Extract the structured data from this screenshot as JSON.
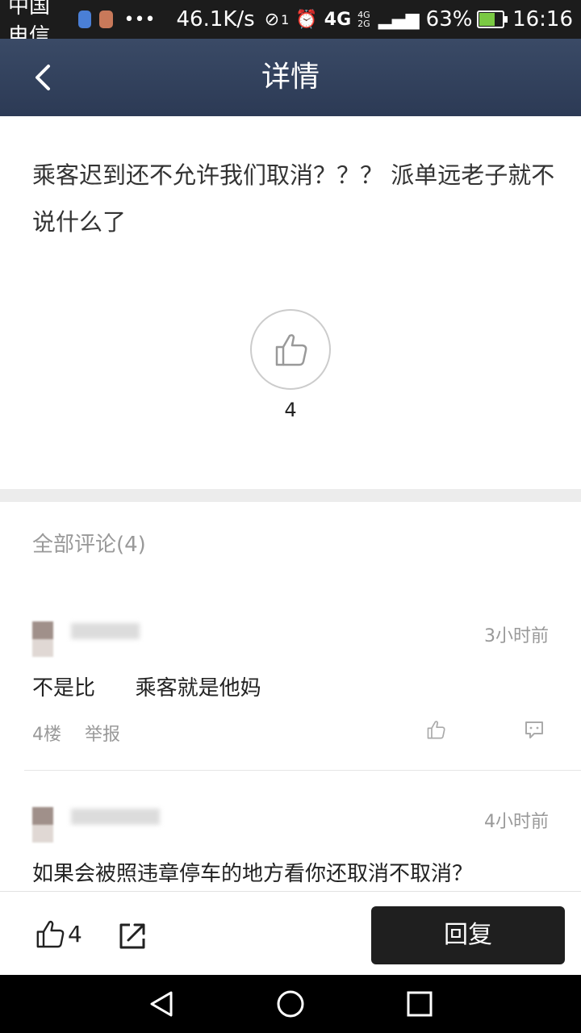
{
  "status_bar": {
    "carrier": "中国电信",
    "speed": "46.1K/s",
    "sim_indicator": "1",
    "network": "4G",
    "network_small": "4G 2G",
    "battery": "63%",
    "time": "16:16"
  },
  "header": {
    "title": "详情",
    "back_icon": "chevron-left-icon"
  },
  "post": {
    "text": "乘客迟到还不允许我们取消？？？ 派单远老子就不说什么了",
    "like_count": "4",
    "like_icon": "thumbs-up-icon"
  },
  "comments_section": {
    "heading": "全部评论(4)",
    "items": [
      {
        "time": "3小时前",
        "text": "不是比      乘客就是他妈",
        "floor": "4楼",
        "report": "举报"
      },
      {
        "time": "4小时前",
        "text": "如果会被照违章停车的地方看你还取消不取消？"
      }
    ]
  },
  "bottom_bar": {
    "like_count": "4",
    "reply_label": "回复",
    "share_icon": "share-icon"
  },
  "nav_bar": {
    "icons": [
      "back-triangle-icon",
      "home-circle-icon",
      "recents-square-icon"
    ]
  },
  "colors": {
    "header_bg": "#2c3a55",
    "reply_button": "#1f1f1f",
    "muted_text": "#999999"
  }
}
